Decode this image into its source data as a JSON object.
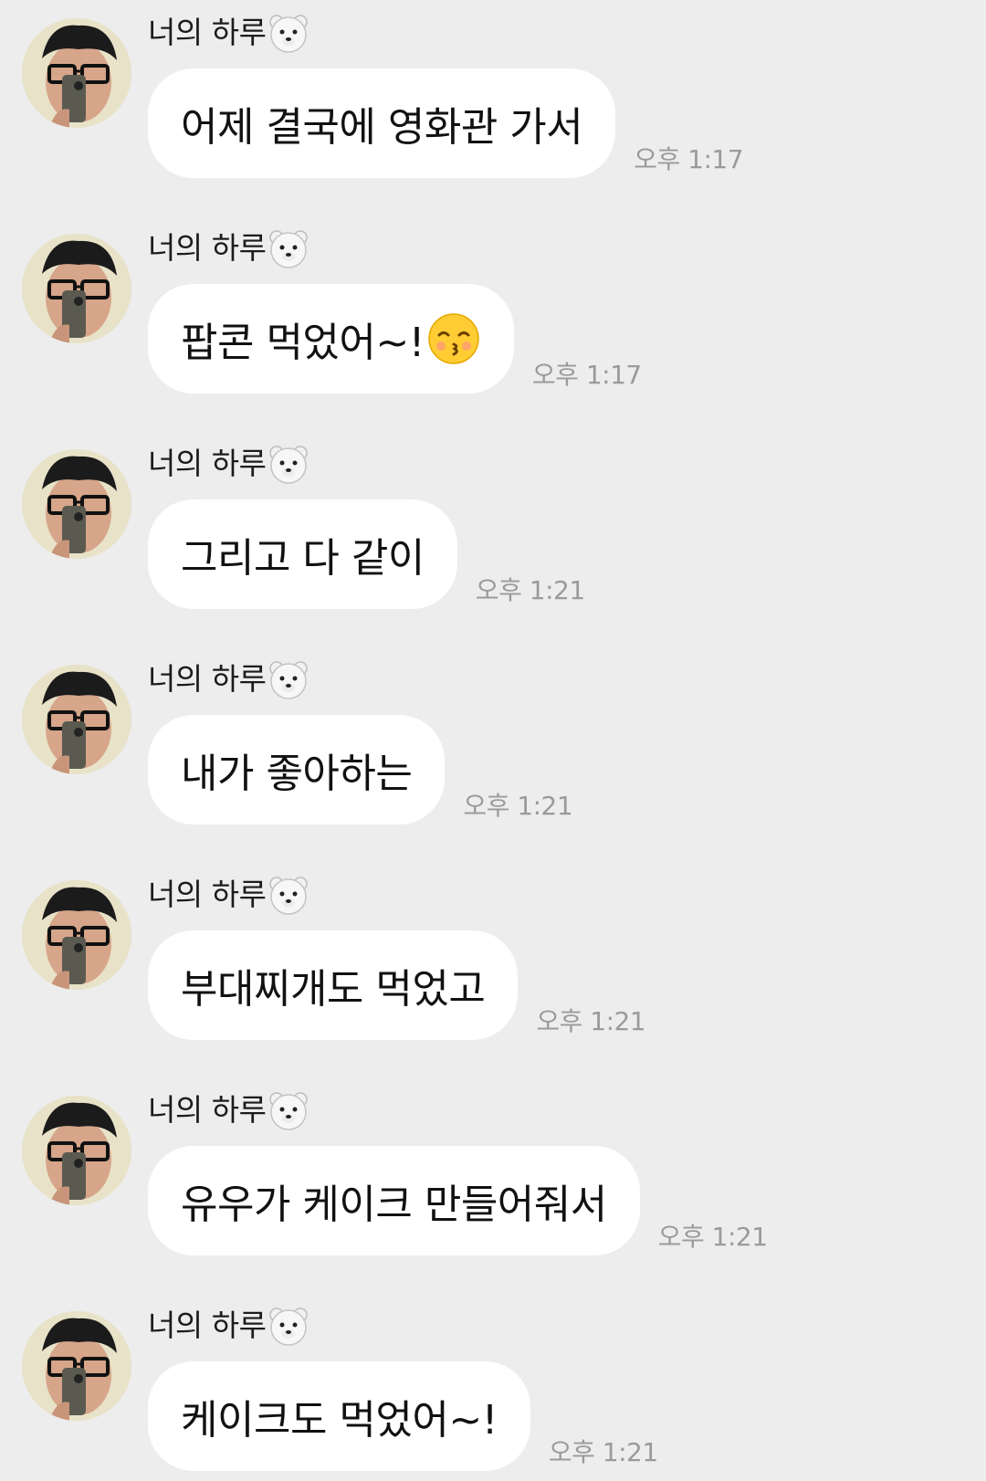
{
  "chat": {
    "messages": [
      {
        "sender": "너의 하루",
        "text": "어제 결국에 영화관 가서",
        "time": "오후 1:17",
        "emoji": ""
      },
      {
        "sender": "너의 하루",
        "text": "팝콘 먹었어~!",
        "time": "오후 1:17",
        "emoji": "kissing-face"
      },
      {
        "sender": "너의 하루",
        "text": "그리고 다 같이",
        "time": "오후 1:21",
        "emoji": ""
      },
      {
        "sender": "너의 하루",
        "text": "내가 좋아하는",
        "time": "오후 1:21",
        "emoji": ""
      },
      {
        "sender": "너의 하루",
        "text": "부대찌개도 먹었고",
        "time": "오후 1:21",
        "emoji": ""
      },
      {
        "sender": "너의 하루",
        "text": "유우가 케이크 만들어줘서",
        "time": "오후 1:21",
        "emoji": ""
      },
      {
        "sender": "너의 하루",
        "text": "케이크도 먹었어~!",
        "time": "오후 1:21",
        "emoji": ""
      }
    ],
    "sender_badge_icon": "polar-bear-icon",
    "colors": {
      "background": "#ededed",
      "bubble": "#ffffff",
      "text": "#111111",
      "timestamp": "#9a9a9a"
    }
  }
}
